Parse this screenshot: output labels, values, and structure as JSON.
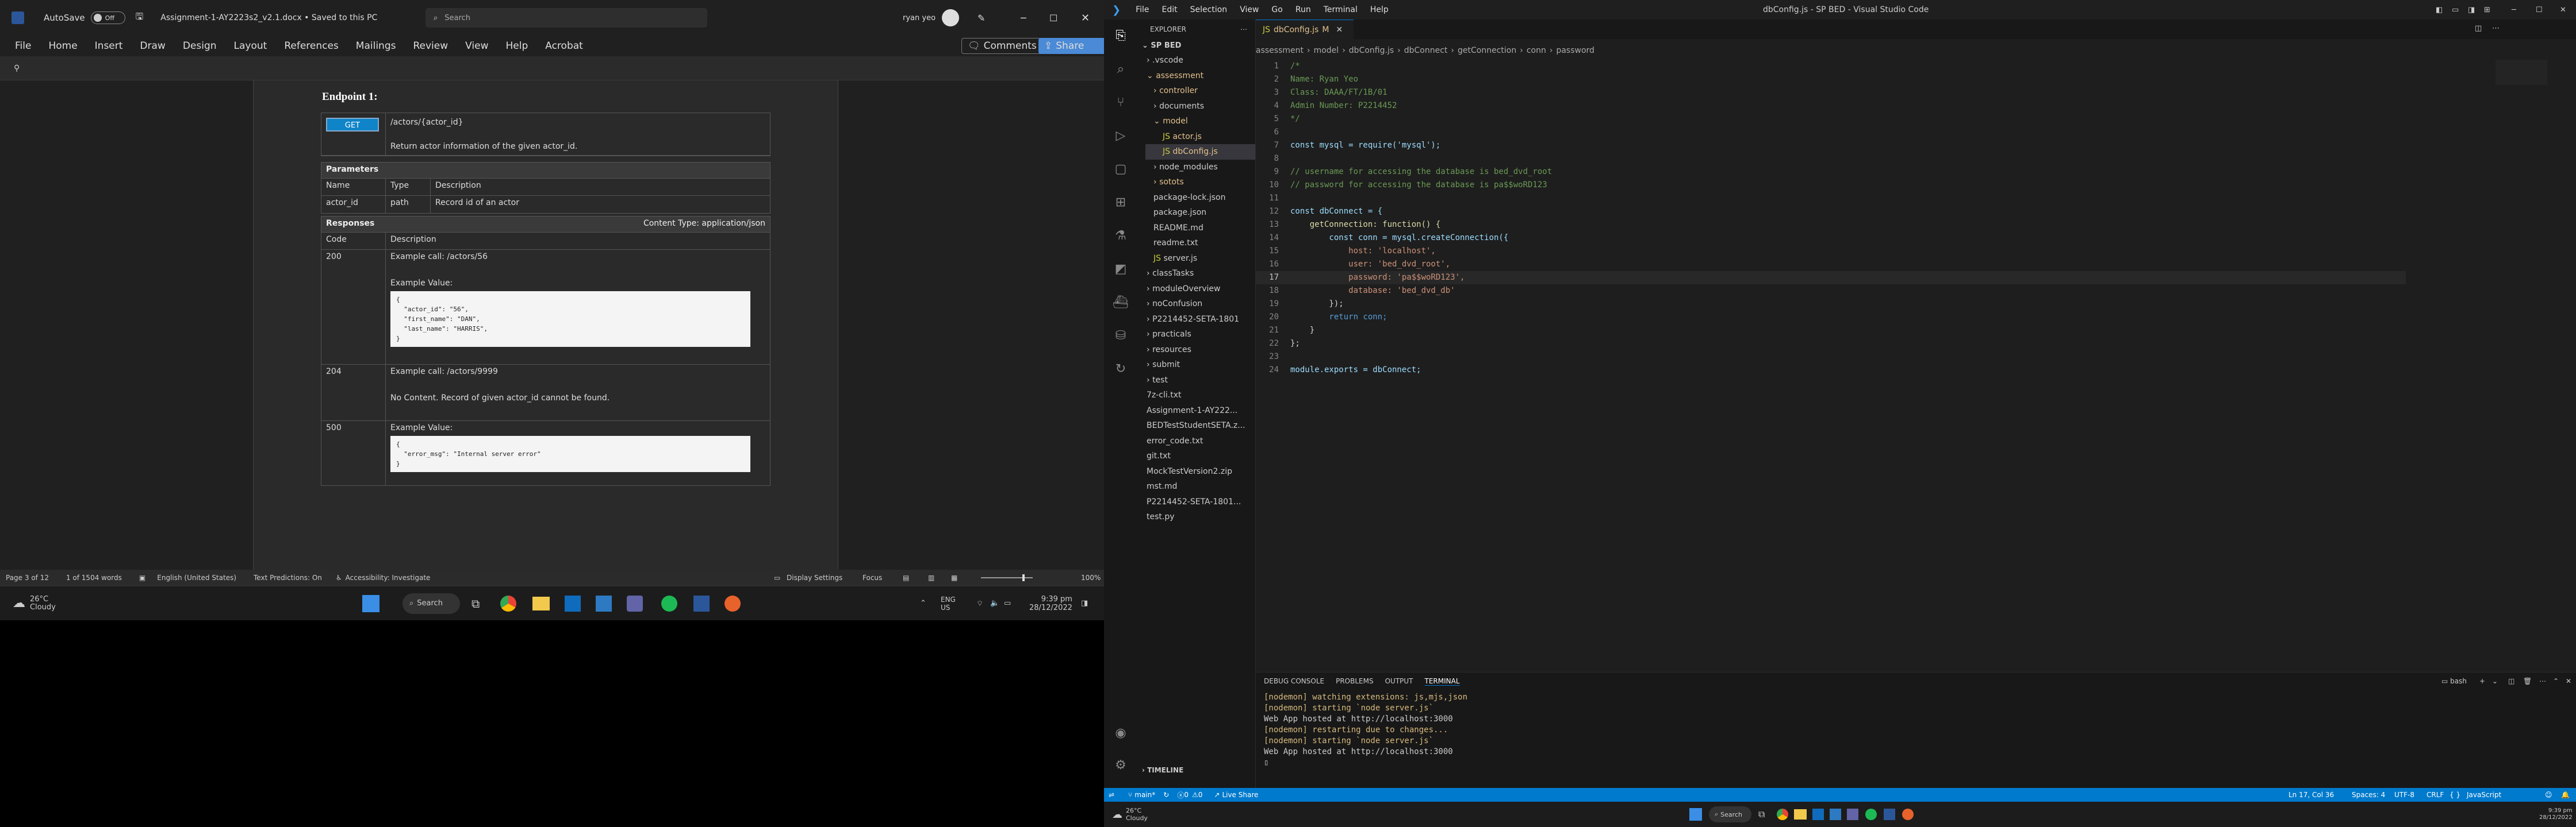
{
  "word": {
    "title": {
      "autosave": "AutoSave",
      "toggle": "Off",
      "doc_name": "Assignment-1-AY2223s2_v2.1.docx • Saved to this PC",
      "search_placeholder": "Search",
      "user": "ryan yeo"
    },
    "ribbon": [
      "File",
      "Home",
      "Insert",
      "Draw",
      "Design",
      "Layout",
      "References",
      "Mailings",
      "Review",
      "View",
      "Help",
      "Acrobat"
    ],
    "comments": "Comments",
    "share": "Share",
    "doc": {
      "heading": "Endpoint 1:",
      "method": "GET",
      "path": "/actors/{actor_id}",
      "summary": "Return actor information of the given actor_id.",
      "params_header": "Parameters",
      "param_cols": [
        "Name",
        "Type",
        "Description"
      ],
      "param_row": [
        "actor_id",
        "path",
        "Record id of an actor"
      ],
      "responses_header": "Responses",
      "content_type": "Content Type: application/json",
      "resp_cols": [
        "Code",
        "Description"
      ],
      "r200": {
        "code": "200",
        "call": "Example call: /actors/56",
        "ev": "Example Value:",
        "json": "{\n  \"actor_id\": \"56\",\n  \"first_name\": \"DAN\",\n  \"last_name\": \"HARRIS\",\n}"
      },
      "r204": {
        "code": "204",
        "call": "Example call: /actors/9999",
        "desc": "No Content. Record of given actor_id cannot be found."
      },
      "r500": {
        "code": "500",
        "ev": "Example Value:",
        "json": "{\n  \"error_msg\": \"Internal server error\"\n}"
      }
    },
    "status": {
      "page": "Page 3 of 12",
      "words": "1 of 1504 words",
      "lang": "English (United States)",
      "pred": "Text Predictions: On",
      "acc": "Accessibility: Investigate",
      "display": "Display Settings",
      "focus": "Focus",
      "zoom": "100%"
    },
    "taskbar": {
      "temp": "26°C",
      "weather": "Cloudy",
      "search": "Search",
      "lang1": "ENG",
      "lang2": "US",
      "time": "9:39 pm",
      "date": "28/12/2022"
    }
  },
  "vscode": {
    "title": "dbConfig.js - SP BED - Visual Studio Code",
    "menu": [
      "File",
      "Edit",
      "Selection",
      "View",
      "Go",
      "Run",
      "Terminal",
      "Help"
    ],
    "explorer_label": "EXPLORER",
    "root": "SP BED",
    "tree": [
      ".vscode",
      "assessment",
      "controller",
      "documents",
      "model",
      "actor.js",
      "dbConfig.js",
      "node_modules",
      "sotots",
      "package-lock.json",
      "package.json",
      "README.md",
      "readme.txt",
      "server.js",
      "classTasks",
      "moduleOverview",
      "noConfusion",
      "P2214452-SETA-1801",
      "practicals",
      "resources",
      "submit",
      "test",
      "7z-cli.txt",
      "Assignment-1-AY222...",
      "BEDTestStudentSETA.z...",
      "error_code.txt",
      "git.txt",
      "MockTestVersion2.zip",
      "mst.md",
      "P2214452-SETA-1801...",
      "test.py"
    ],
    "tab": "dbConfig.js",
    "tab_m": "M",
    "breadcrumb": [
      "assessment",
      "model",
      "dbConfig.js",
      "dbConnect",
      "getConnection",
      "conn",
      "password"
    ],
    "code": [
      "/*",
      "Name: Ryan Yeo",
      "Class: DAAA/FT/1B/01",
      "Admin Number: P2214452",
      "*/",
      "",
      "const mysql = require('mysql');",
      "",
      "// username for accessing the database is bed_dvd_root",
      "// password for accessing the database is pa$$woRD123",
      "",
      "const dbConnect = {",
      "    getConnection: function() {",
      "        const conn = mysql.createConnection({",
      "            host: 'localhost',",
      "            user: 'bed_dvd_root',",
      "            password: 'pa$$woRD123',",
      "            database: 'bed_dvd_db'",
      "        });",
      "        return conn;",
      "    }",
      "};",
      "",
      "module.exports = dbConnect;"
    ],
    "panel_tabs": [
      "DEBUG CONSOLE",
      "PROBLEMS",
      "OUTPUT",
      "TERMINAL"
    ],
    "term_shell": "bash",
    "terminal": [
      "[nodemon] watching extensions: js,mjs,json",
      "[nodemon] starting `node server.js`",
      "Web App hosted at http://localhost:3000",
      "[nodemon] restarting due to changes...",
      "[nodemon] starting `node server.js`",
      "Web App hosted at http://localhost:3000"
    ],
    "timeline": "TIMELINE",
    "status": {
      "branch": "main*",
      "errors": "0",
      "warnings": "0",
      "live": "Live Share",
      "pos": "Ln 17, Col 36",
      "spaces": "Spaces: 4",
      "enc": "UTF-8",
      "eol": "CRLF",
      "lang": "JavaScript"
    },
    "taskbar": {
      "temp": "26°C",
      "weather": "Cloudy",
      "search": "Search",
      "time": "9:39 pm",
      "date": "28/12/2022"
    }
  }
}
